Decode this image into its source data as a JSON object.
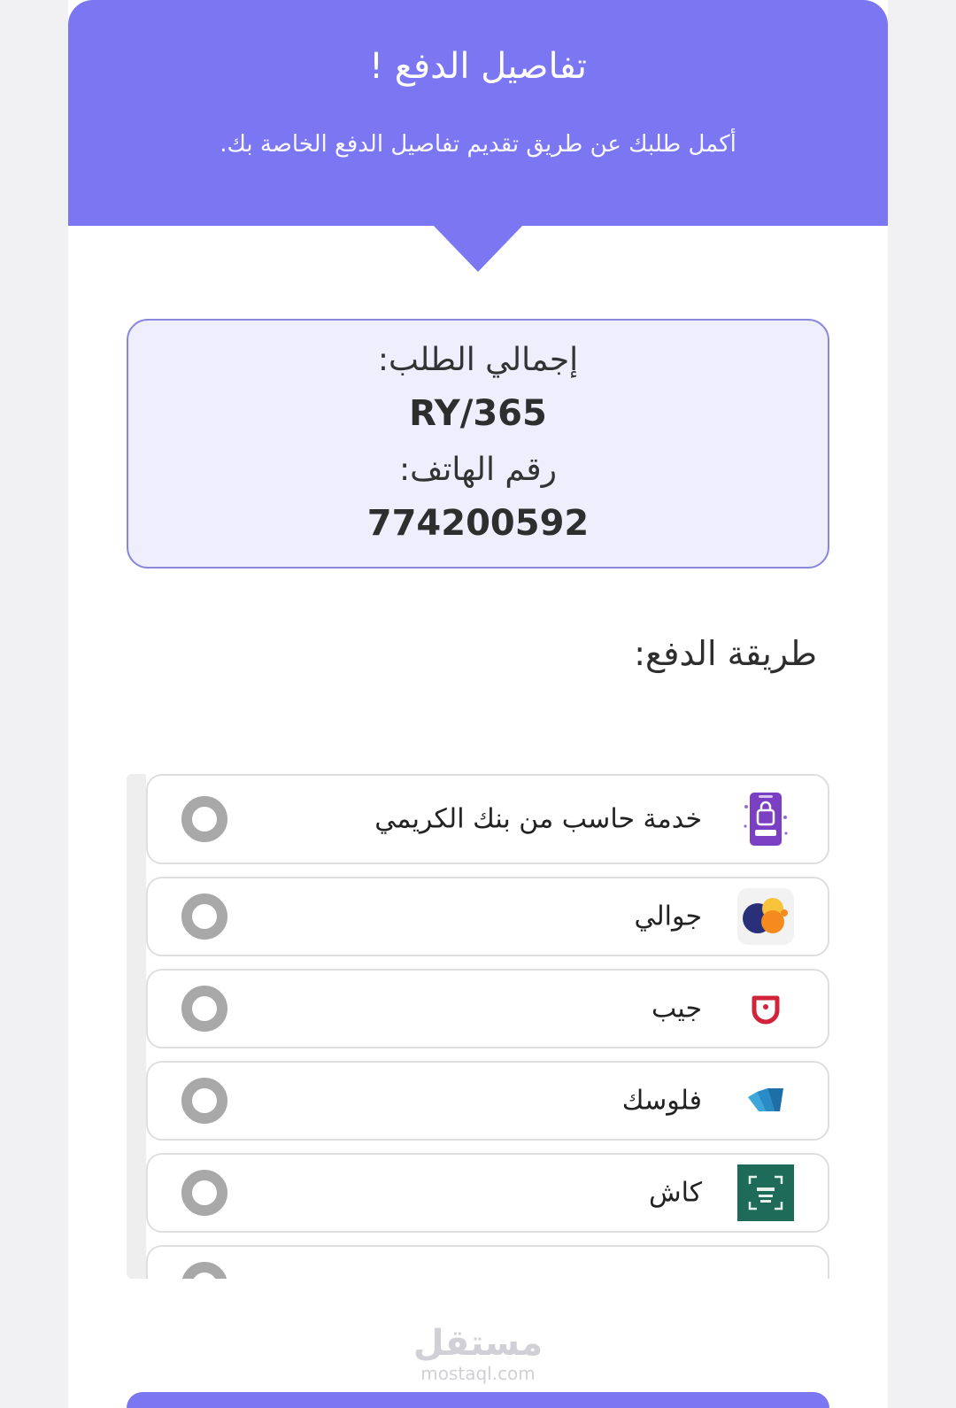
{
  "header": {
    "title": "تفاصيل الدفع !",
    "subtitle": "أكمل طلبك عن طريق تقديم تفاصيل الدفع الخاصة بك."
  },
  "summary": {
    "total_label": "إجمالي الطلب:",
    "total_value": "RY/365",
    "phone_label": "رقم الهاتف:",
    "phone_value": "774200592"
  },
  "payment": {
    "title": "طريقة الدفع:",
    "options": [
      {
        "label": "خدمة حاسب من بنك الكريمي",
        "icon": "hasib-phone-icon",
        "selected": false
      },
      {
        "label": "جوالي",
        "icon": "jawali-circles-icon",
        "selected": false
      },
      {
        "label": "جيب",
        "icon": "jaib-pocket-icon",
        "selected": false
      },
      {
        "label": "فلوسك",
        "icon": "floosak-cards-icon",
        "selected": false
      },
      {
        "label": "كاش",
        "icon": "cash-qr-icon",
        "selected": false
      }
    ]
  },
  "watermark": {
    "arabic": "مستقل",
    "latin": "mostaql.com"
  },
  "colors": {
    "accent": "#7b76f1",
    "summary_bg": "#eeeefd",
    "summary_border": "#8b87dc",
    "radio": "#a8a8a8",
    "cash_green": "#1f6b5a",
    "jaib_red": "#d0243a",
    "floosak_blue": "#1e6fa8",
    "jawali_orange": "#f58a1f",
    "jawali_navy": "#2a2f7a",
    "hasib_purple": "#7b3fc4"
  }
}
